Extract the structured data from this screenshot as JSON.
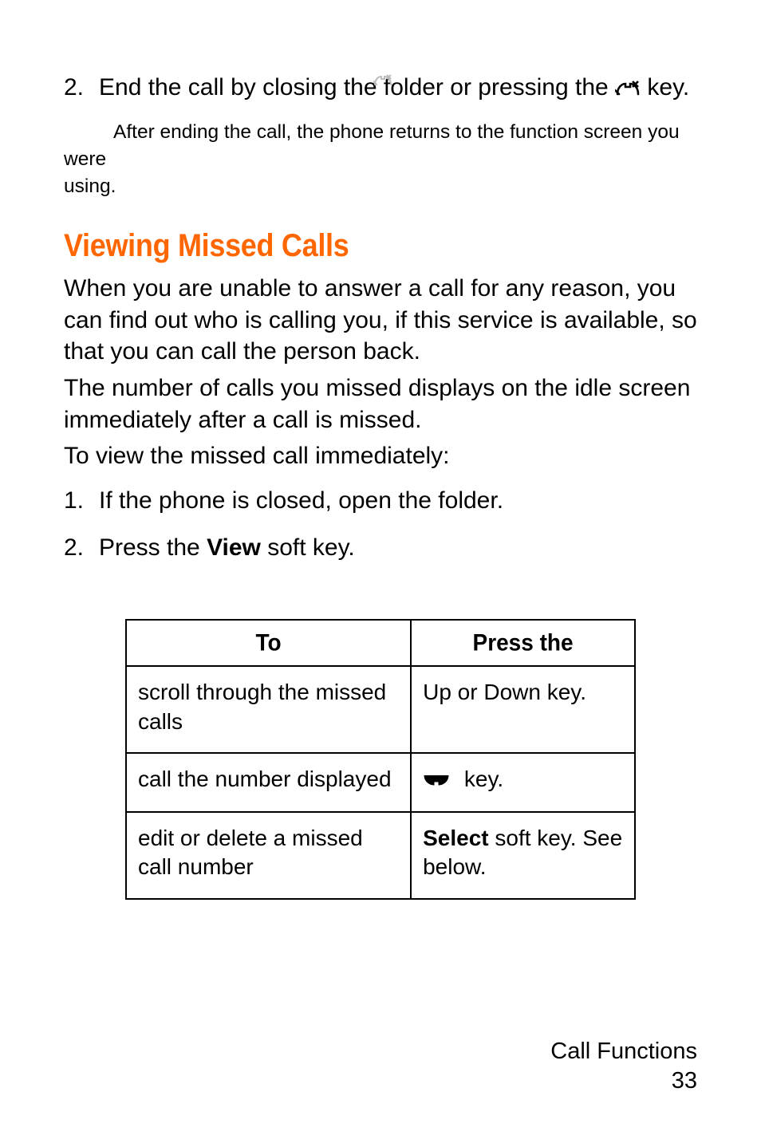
{
  "step2": {
    "num": "2.",
    "before": "End the call by closing the folder or pressing the ",
    "after": " key."
  },
  "note_line1": "After ending the call, the phone returns to the function screen you were",
  "note_line2": "using.",
  "heading": "Viewing Missed Calls",
  "para1_a": "When you are unable to answer a call for any reason, you can find out who is calling you, if this service is available, so that you can call the person back.",
  "para1_b": "The number of calls you missed displays on the idle screen immediately after a call is missed.",
  "para1_c": "To view the missed call immediately:",
  "list": [
    {
      "num": "1.",
      "text": "If the phone is closed, open the folder."
    },
    {
      "num": "2.",
      "text_before": "Press the ",
      "bold": "View",
      "text_after": " soft key."
    }
  ],
  "table": {
    "head": {
      "to": "To",
      "press": "Press the"
    },
    "rows": [
      {
        "to": "scroll through the missed calls",
        "press": "Up or Down key."
      },
      {
        "to": "call the number displayed",
        "press_after": " key."
      },
      {
        "to": "edit or delete a missed call number",
        "press_bold": "Select",
        "press_after": " soft key. See below."
      }
    ]
  },
  "footer": {
    "section": "Call Functions",
    "page": "33"
  },
  "chart_data": {
    "type": "table",
    "title": "",
    "columns": [
      "To",
      "Press the"
    ],
    "rows": [
      [
        "scroll through the missed calls",
        "Up or Down key."
      ],
      [
        "call the number displayed",
        "[phone] key."
      ],
      [
        "edit or delete a missed call number",
        "Select soft key. See below."
      ]
    ]
  }
}
